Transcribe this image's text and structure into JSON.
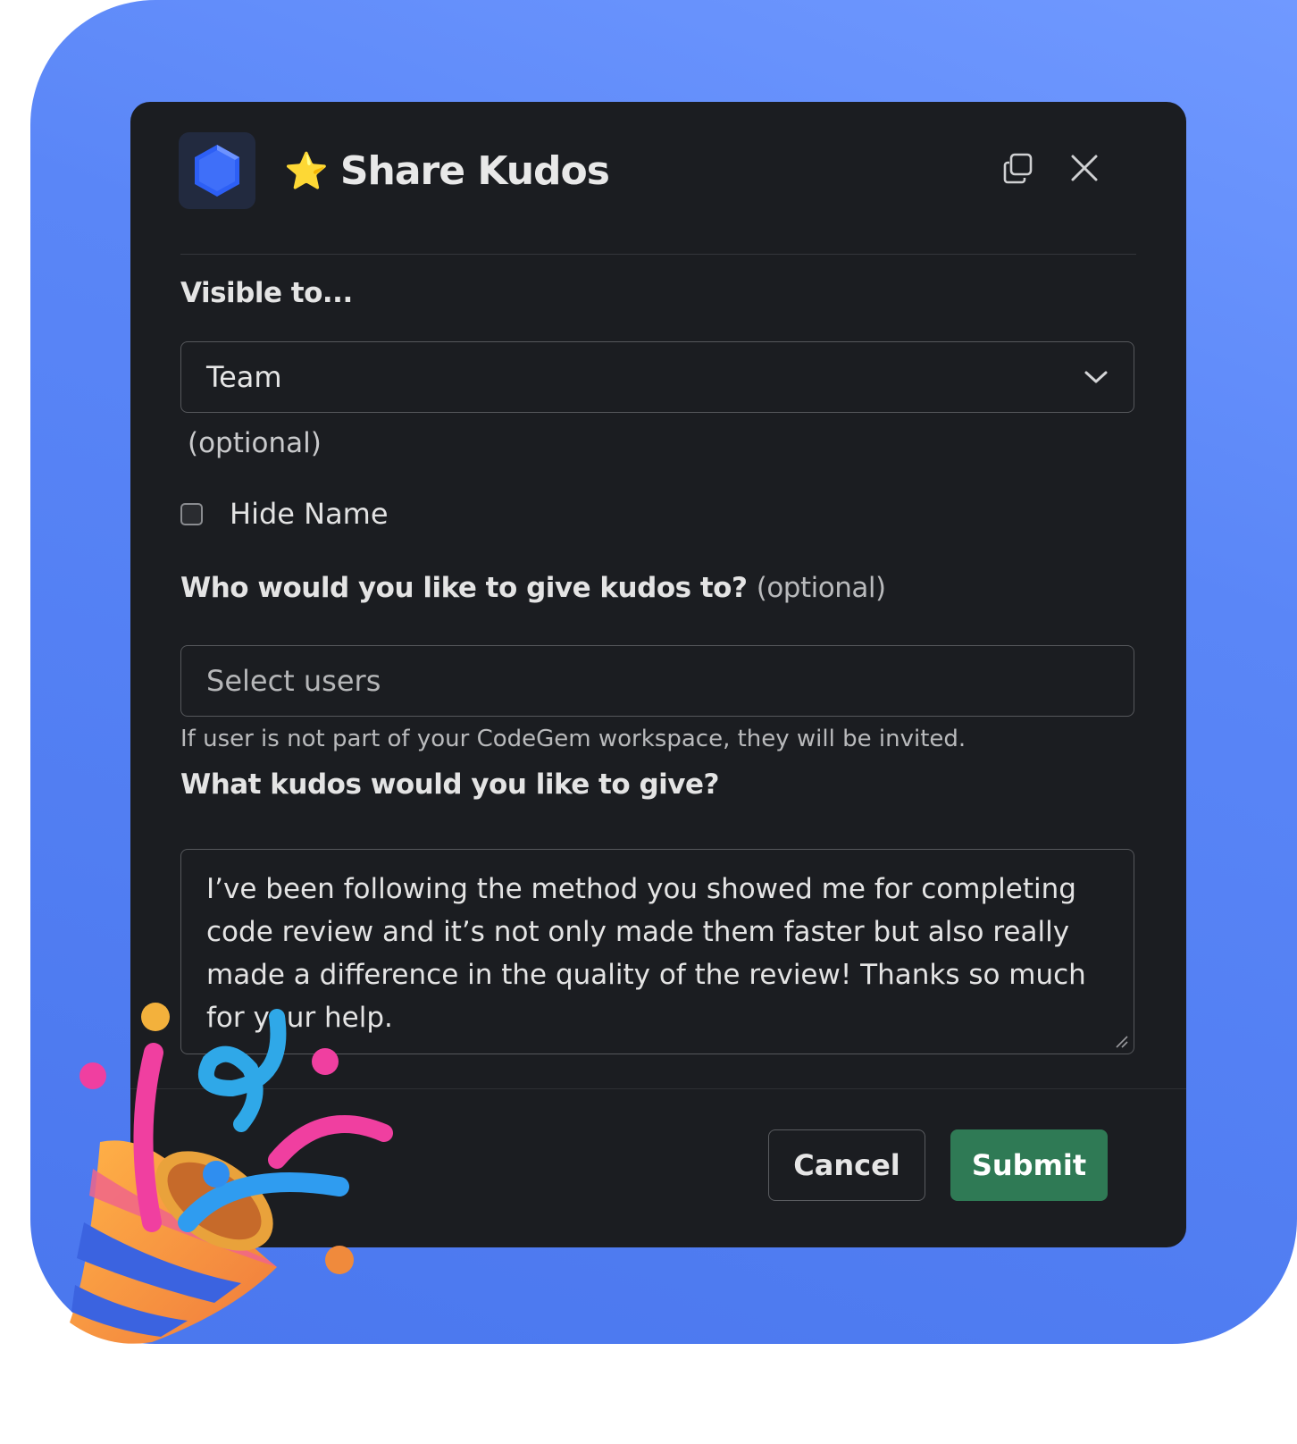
{
  "modal": {
    "title_emoji": "⭐",
    "title": "Share Kudos",
    "visible_to_label": "Visible to...",
    "visible_to_value": "Team",
    "optional_text": "(optional)",
    "hide_name_label": "Hide Name",
    "who_label": "Who would you like to give kudos to?",
    "who_optional": "(optional)",
    "users_placeholder": "Select users",
    "users_hint": "If user is not part of your CodeGem workspace, they will be invited.",
    "what_label": "What kudos would you like to give?",
    "message": "I’ve been following the method you showed me for completing code review and it’s not only made them faster but also really made a difference in the quality of the review! Thanks so much for your help.",
    "cancel_label": "Cancel",
    "submit_label": "Submit"
  },
  "icons": {
    "app": "hexagon-logo-icon",
    "copy": "copy-icon",
    "close": "close-icon",
    "dropdown": "chevron-down-icon",
    "decoration": "party-popper-icon"
  },
  "colors": {
    "background": "#5a86f7",
    "modal": "#1b1d21",
    "submit": "#2f7a55"
  }
}
